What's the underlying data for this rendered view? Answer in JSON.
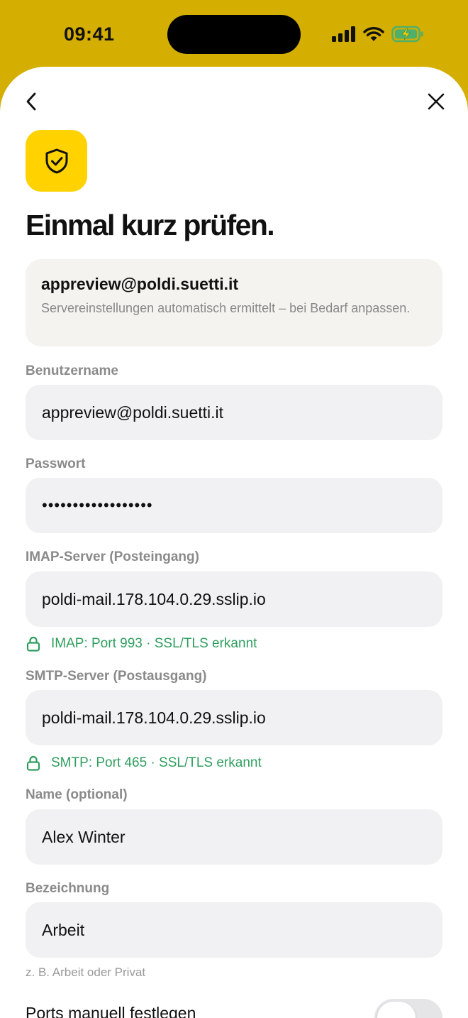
{
  "status_bar": {
    "time": "09:41",
    "icons": [
      "cellular-signal-icon",
      "wifi-icon",
      "battery-charging-icon"
    ]
  },
  "nav": {
    "back_icon": "chevron-left-icon",
    "close_icon": "close-icon"
  },
  "header": {
    "icon": "shield-check-icon",
    "title": "Einmal kurz prüfen."
  },
  "info_card": {
    "email": "appreview@poldi.suetti.it",
    "description": "Servereinstellungen automatisch ermittelt – bei Bedarf anpassen."
  },
  "form": {
    "username": {
      "label": "Benutzername",
      "value": "appreview@poldi.suetti.it"
    },
    "password": {
      "label": "Passwort",
      "value": "••••••••••••••••••"
    },
    "imap": {
      "label": "IMAP-Server (Posteingang)",
      "value": "poldi-mail.178.104.0.29.sslip.io",
      "hint": "IMAP: Port 993 · SSL/TLS erkannt"
    },
    "smtp": {
      "label": "SMTP-Server (Postausgang)",
      "value": "poldi-mail.178.104.0.29.sslip.io",
      "hint": "SMTP: Port 465 · SSL/TLS erkannt"
    },
    "name": {
      "label": "Name (optional)",
      "value": "Alex Winter"
    },
    "designation": {
      "label": "Bezeichnung",
      "value": "Arbeit",
      "hint": "z. B. Arbeit oder Privat"
    },
    "manual_ports": {
      "label": "Ports manuell festlegen",
      "enabled": false
    }
  },
  "colors": {
    "background": "#D4AE00",
    "accent": "#FFD200",
    "success": "#2E9E5E",
    "field_bg": "#F1F1F3"
  }
}
